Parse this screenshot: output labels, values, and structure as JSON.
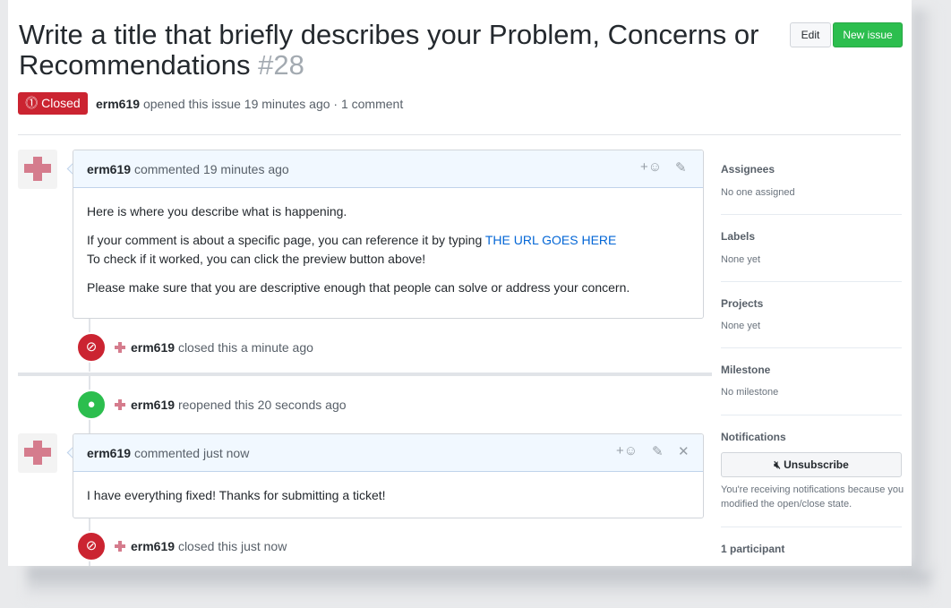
{
  "issue": {
    "title": "Write a title that briefly describes your Problem, Concerns or Recommendations",
    "number": "#28",
    "state": "Closed",
    "author": "erm619",
    "opened_text": "opened this issue 19 minutes ago · 1 comment"
  },
  "header_buttons": {
    "edit": "Edit",
    "new_issue": "New issue"
  },
  "comments": [
    {
      "author": "erm619",
      "time": "commented 19 minutes ago",
      "body": [
        "Here is where you describe what is happening.",
        "If your comment is about a specific page, you can reference it by typing",
        "THE URL GOES HERE",
        "To check if it worked, you can click the preview button above!",
        "Please make sure that you are descriptive enough that people can solve or address your concern."
      ]
    },
    {
      "author": "erm619",
      "time": "commented just now",
      "body": [
        "I have everything fixed! Thanks for submitting a ticket!"
      ]
    }
  ],
  "events": [
    {
      "author": "erm619",
      "text": "closed this a minute ago",
      "type": "closed"
    },
    {
      "author": "erm619",
      "text": "reopened this 20 seconds ago",
      "type": "reopened"
    },
    {
      "author": "erm619",
      "text": "closed this just now",
      "type": "closed"
    }
  ],
  "sidebar": {
    "assignees": {
      "label": "Assignees",
      "value": "No one assigned"
    },
    "labels": {
      "label": "Labels",
      "value": "None yet"
    },
    "projects": {
      "label": "Projects",
      "value": "None yet"
    },
    "milestone": {
      "label": "Milestone",
      "value": "No milestone"
    },
    "notifications": {
      "label": "Notifications",
      "button": "Unsubscribe",
      "reason": "You're receiving notifications because you modified the open/close state."
    },
    "participants": {
      "label": "1 participant"
    }
  },
  "icons": {
    "state": "issue-closed-icon",
    "reaction": "smiley-icon",
    "edit": "pencil-icon",
    "delete": "x-icon",
    "closed_event": "circle-slash-icon",
    "reopened_event": "dot-icon",
    "mute": "mute-icon"
  },
  "colors": {
    "closed": "#cb2431",
    "green": "#2cbe4e",
    "link": "#0366d6",
    "comment_header": "#f1f8ff"
  }
}
